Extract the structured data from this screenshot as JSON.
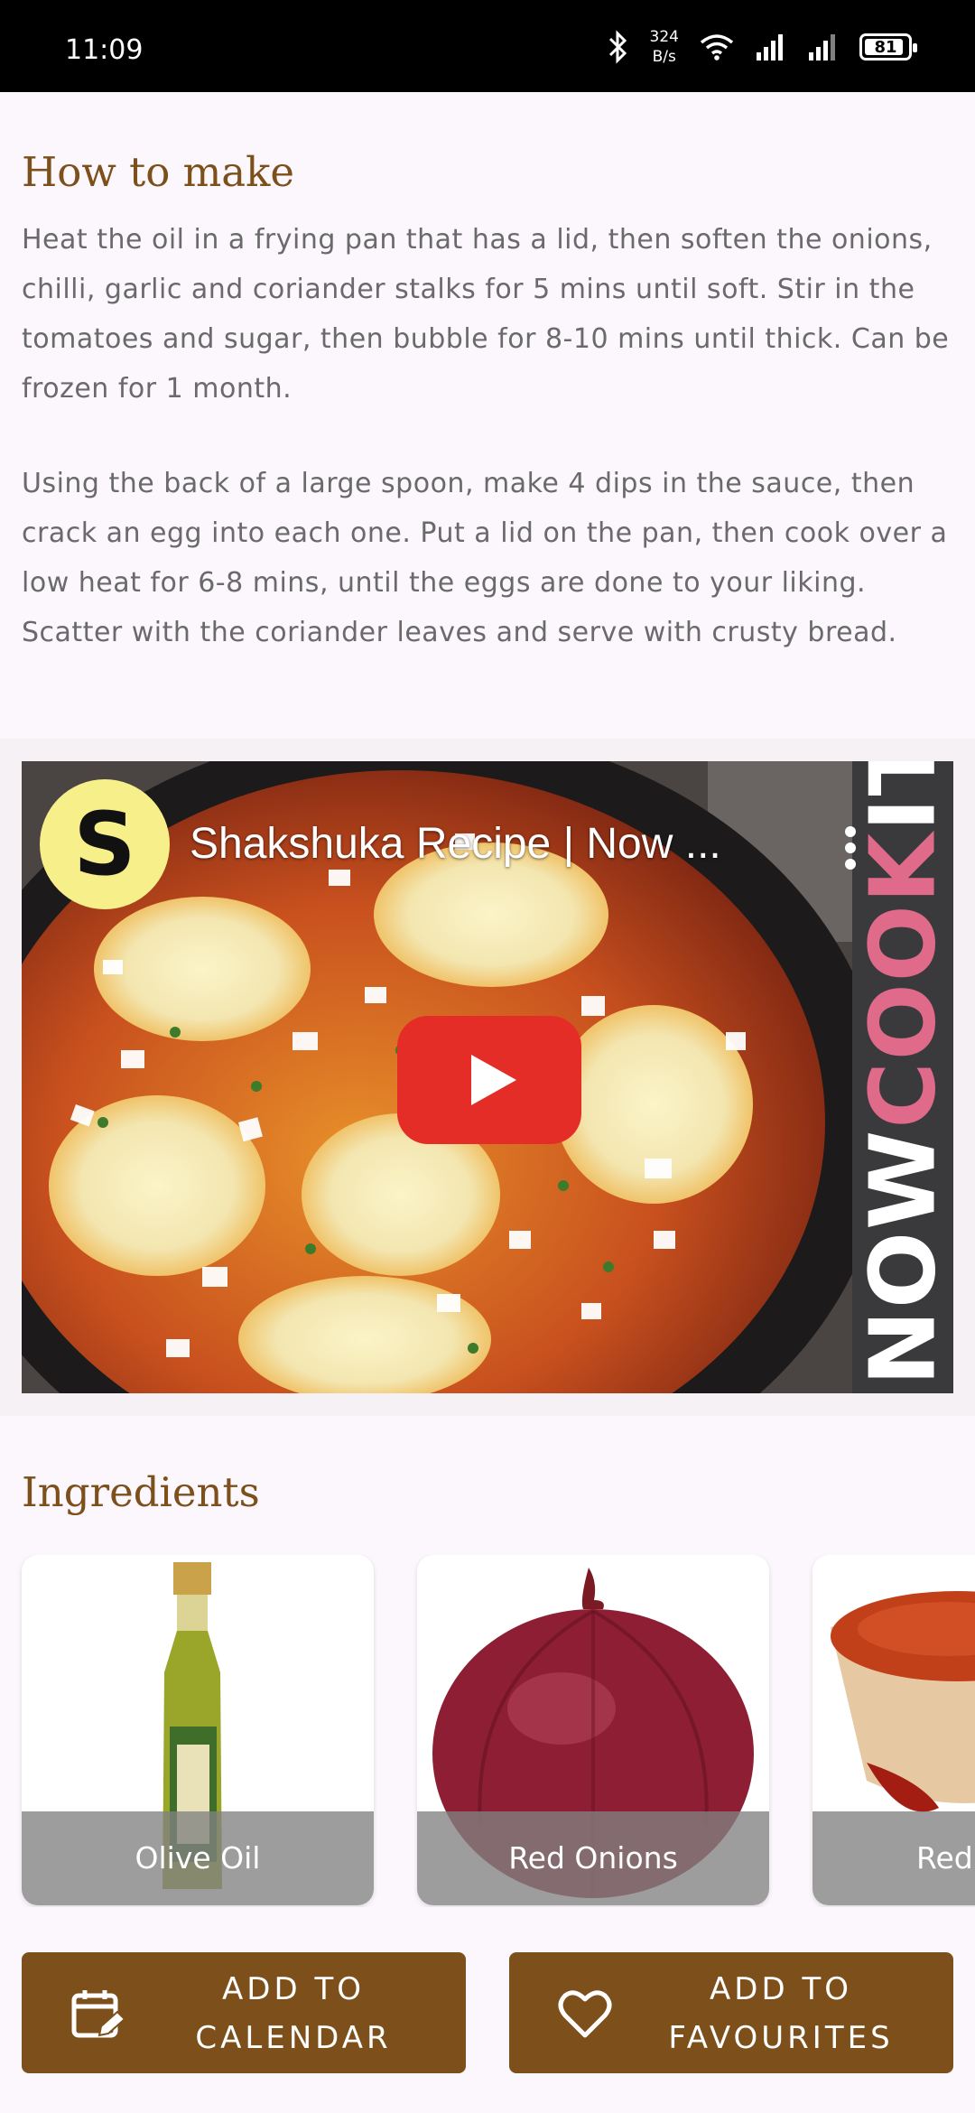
{
  "status_bar": {
    "time": "11:09",
    "net_speed_value": "324",
    "net_speed_unit": "B/s",
    "battery": "81",
    "battery_level": 0.81,
    "icons": [
      "bluetooth-icon",
      "wifi-icon",
      "signal-icon",
      "signal-icon",
      "battery-icon"
    ]
  },
  "how_to_make": {
    "heading": "How to make",
    "paragraphs": [
      "Heat the oil in a frying pan that has a lid, then soften the onions, chilli, garlic and coriander stalks for 5 mins until soft. Stir in the tomatoes and sugar, then bubble for 8-10 mins until thick. Can be frozen for 1 month.",
      "Using the back of a large spoon, make 4 dips in the sauce, then crack an egg into each one. Put a lid on the pan, then cook over a low heat for 6-8 mins, until the eggs are done to your liking. Scatter with the coriander leaves and serve with crusty bread."
    ]
  },
  "video": {
    "channel_initial": "S",
    "title": "Shakshuka Recipe | Now ...",
    "banner_words": [
      "NOW",
      "COOK",
      "IT"
    ],
    "icons": [
      "more-vert-icon",
      "play-icon"
    ]
  },
  "ingredients": {
    "heading": "Ingredients",
    "items": [
      {
        "name": "Olive Oil",
        "image": "olive-oil-bottle"
      },
      {
        "name": "Red Onions",
        "image": "red-onion"
      },
      {
        "name": "Red",
        "image": "red-spice-bowl"
      }
    ]
  },
  "actions": {
    "calendar_line1": "ADD TO",
    "calendar_line2": "CALENDAR",
    "favourites_line1": "ADD TO",
    "favourites_line2": "FAVOURITES"
  },
  "colors": {
    "brand_brown": "#7d4f1a",
    "youtube_red": "#e52d27",
    "body_text": "#6a6a6a"
  }
}
